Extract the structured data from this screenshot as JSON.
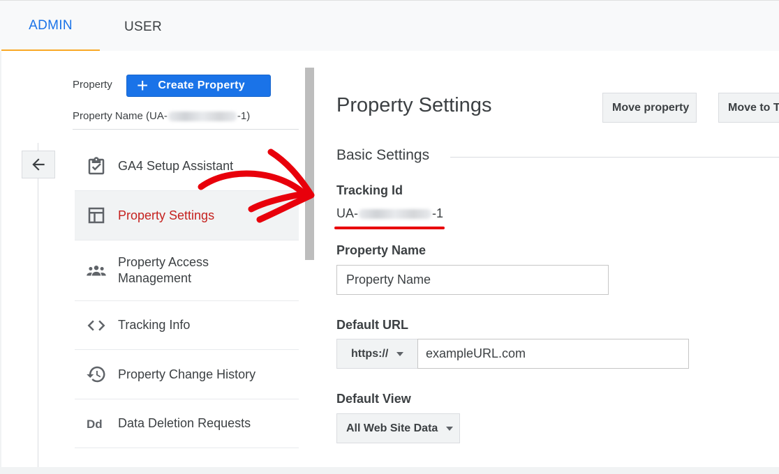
{
  "tabs": {
    "admin": "ADMIN",
    "user": "USER"
  },
  "sidebar": {
    "property_label": "Property",
    "create_button": {
      "icon": "plus-icon",
      "label": "Create Property"
    },
    "property_name_prefix": "Property Name (UA-",
    "property_name_suffix": "-1)",
    "items": [
      {
        "label": "GA4 Setup Assistant",
        "icon": "clipboard-check-icon",
        "active": false
      },
      {
        "label": "Property Settings",
        "icon": "layout-panel-icon",
        "active": true
      },
      {
        "label": "Property Access Management",
        "icon": "people-icon",
        "active": false
      },
      {
        "label": "Tracking Info",
        "icon": "code-brackets-icon",
        "active": false
      },
      {
        "label": "Property Change History",
        "icon": "history-icon",
        "active": false
      },
      {
        "label": "Data Deletion Requests",
        "icon": "dd-icon",
        "active": false
      }
    ]
  },
  "main": {
    "title": "Property Settings",
    "buttons": {
      "move_property": "Move property",
      "move_to": "Move to T"
    },
    "section": "Basic Settings",
    "tracking_id_label": "Tracking Id",
    "tracking_id_prefix": "UA-",
    "tracking_id_suffix": "-1",
    "property_name_label": "Property Name",
    "property_name_value": "Property Name",
    "default_url_label": "Default URL",
    "protocol_value": "https://",
    "url_value": "exampleURL.com",
    "default_view_label": "Default View",
    "default_view_value": "All Web Site Data"
  },
  "colors": {
    "accent": "#1a73e8",
    "active_text": "#c5221f",
    "annotation": "#e8000b",
    "tab_indicator": "#f9a825"
  }
}
